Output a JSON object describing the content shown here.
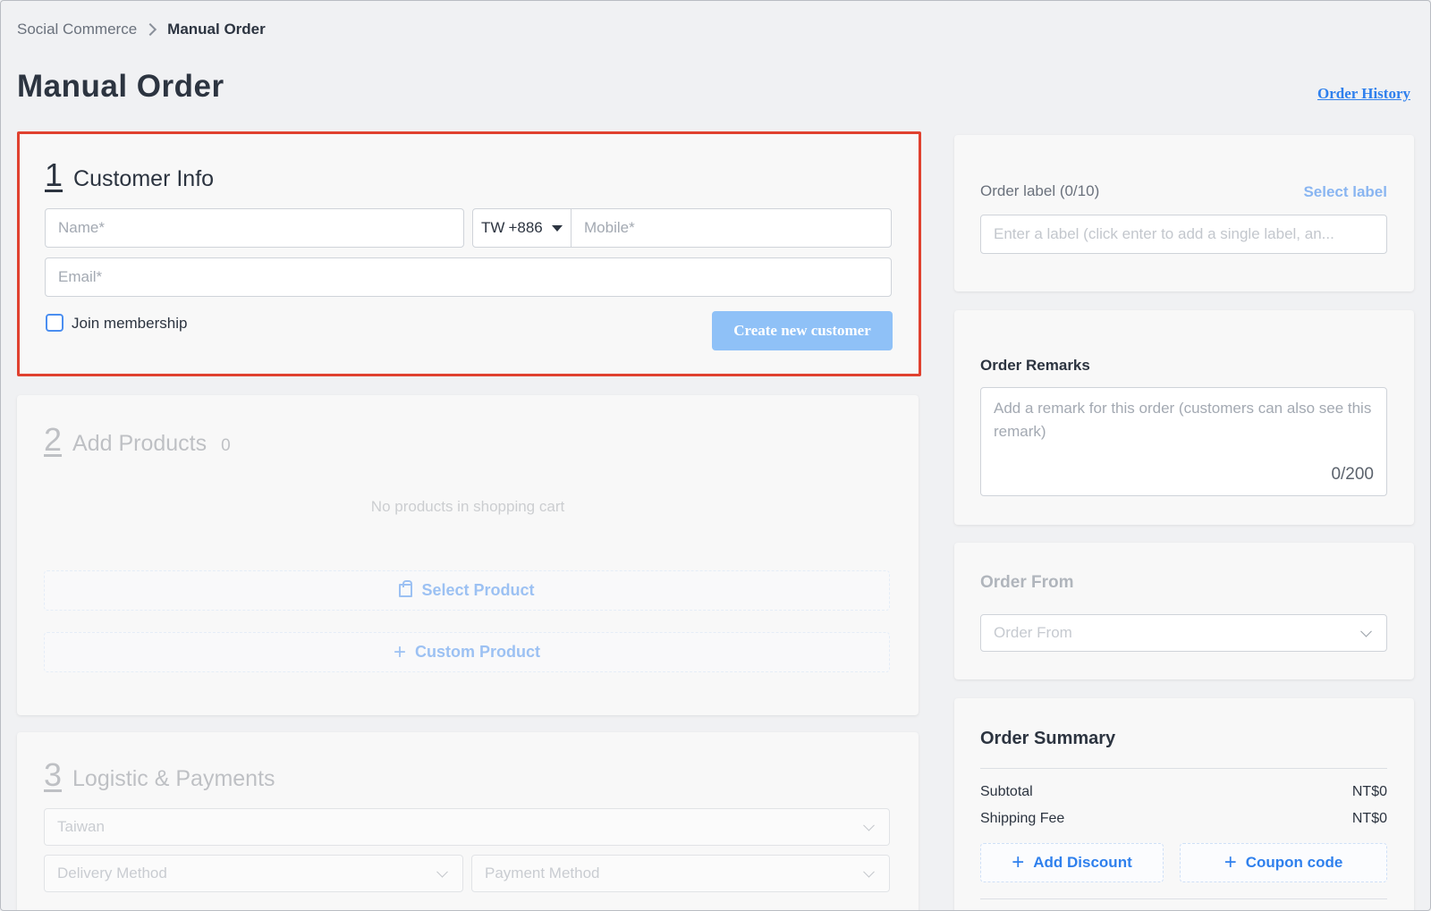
{
  "breadcrumb": {
    "root": "Social Commerce",
    "current": "Manual Order"
  },
  "page": {
    "title": "Manual Order",
    "history_link": "Order History"
  },
  "customer": {
    "step": "1",
    "title": "Customer Info",
    "name_placeholder": "Name*",
    "country_code": "TW",
    "dial_code": "+886",
    "mobile_placeholder": "Mobile*",
    "email_placeholder": "Email*",
    "membership_label": "Join membership",
    "create_button": "Create new customer"
  },
  "products": {
    "step": "2",
    "title": "Add Products",
    "count": "0",
    "empty_text": "No products in shopping cart",
    "select_button": "Select Product",
    "custom_button": "Custom Product"
  },
  "logistics": {
    "step": "3",
    "title": "Logistic & Payments",
    "country_value": "Taiwan",
    "delivery_placeholder": "Delivery Method",
    "payment_placeholder": "Payment Method"
  },
  "label_panel": {
    "title": "Order label (0/10)",
    "select_link": "Select label",
    "placeholder": "Enter a label (click enter to add a single label, an..."
  },
  "remarks": {
    "title": "Order Remarks",
    "placeholder": "Add a remark for this order (customers can also see this remark)",
    "counter": "0/200"
  },
  "order_from": {
    "title": "Order From",
    "placeholder": "Order From"
  },
  "summary": {
    "title": "Order Summary",
    "subtotal_label": "Subtotal",
    "subtotal_value": "NT$0",
    "shipping_label": "Shipping Fee",
    "shipping_value": "NT$0",
    "discount_button": "Add Discount",
    "coupon_button": "Coupon code"
  },
  "colors": {
    "accent": "#2f80ed",
    "highlight": "#e0412f",
    "button_disabled": "#8fc1f7"
  }
}
